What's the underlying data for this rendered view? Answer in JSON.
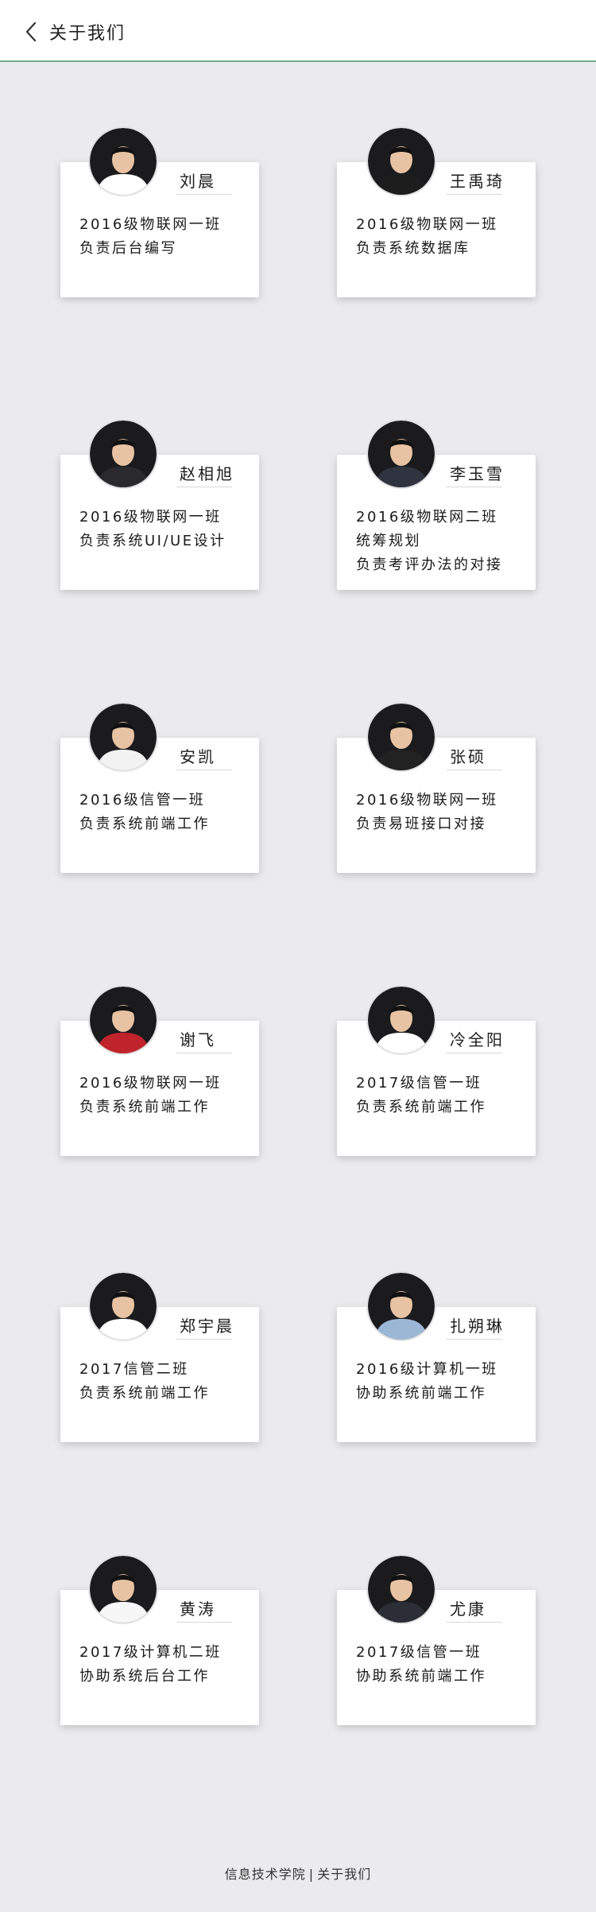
{
  "header": {
    "title": "关于我们"
  },
  "members": [
    {
      "name": "刘晨",
      "lines": [
        "2016级物联网一班",
        "负责后台编写"
      ],
      "shirt": "#ffffff"
    },
    {
      "name": "王禹琦",
      "lines": [
        "2016级物联网一班",
        "负责系统数据库"
      ],
      "shirt": "#1d1d1d"
    },
    {
      "name": "赵相旭",
      "lines": [
        "2016级物联网一班",
        "负责系统UI/UE设计"
      ],
      "shirt": "#2a2a2e"
    },
    {
      "name": "李玉雪",
      "lines": [
        "2016级物联网二班",
        "统筹规划",
        "负责考评办法的对接"
      ],
      "shirt": "#2f3440"
    },
    {
      "name": "安凯",
      "lines": [
        "2016级信管一班",
        "负责系统前端工作"
      ],
      "shirt": "#f2f2f2"
    },
    {
      "name": "张硕",
      "lines": [
        "2016级物联网一班",
        "负责易班接口对接"
      ],
      "shirt": "#222222"
    },
    {
      "name": "谢飞",
      "lines": [
        "2016级物联网一班",
        "负责系统前端工作"
      ],
      "shirt": "#c0232b"
    },
    {
      "name": "冷全阳",
      "lines": [
        "2017级信管一班",
        "负责系统前端工作"
      ],
      "shirt": "#ffffff"
    },
    {
      "name": "郑宇晨",
      "lines": [
        "2017信管二班",
        "负责系统前端工作"
      ],
      "shirt": "#ffffff"
    },
    {
      "name": "扎朔琳",
      "lines": [
        "2016级计算机一班",
        "协助系统前端工作"
      ],
      "shirt": "#9cb6d6"
    },
    {
      "name": "黄涛",
      "lines": [
        "2017级计算机二班",
        "协助系统后台工作"
      ],
      "shirt": "#f7f7f7"
    },
    {
      "name": "尤康",
      "lines": [
        "2017级信管一班",
        "协助系统前端工作"
      ],
      "shirt": "#2b2e36"
    }
  ],
  "footer": {
    "school": "信息技术学院",
    "page": "关于我们"
  }
}
